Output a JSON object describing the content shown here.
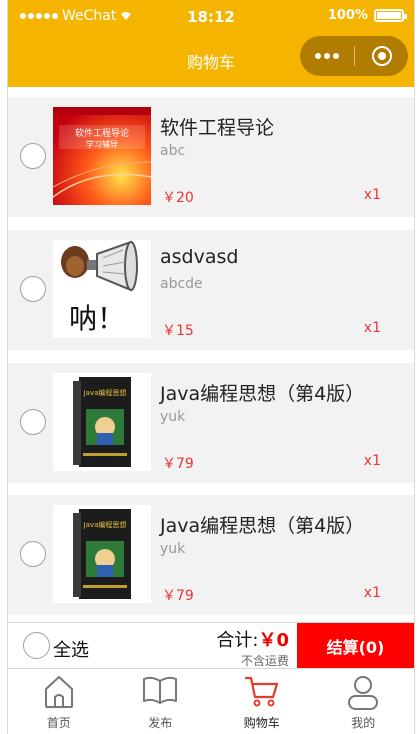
{
  "status_bar": {
    "carrier": "WeChat",
    "time": "18:12",
    "battery": "100%"
  },
  "nav": {
    "title": "购物车"
  },
  "cart_items": [
    {
      "name": "软件工程导论",
      "desc": "abc",
      "price": "￥20",
      "qty": "x1",
      "thumb_icon": "software-engineering-book-cover",
      "thumb_text": "软件工程导论 学习辅导"
    },
    {
      "name": "asdvasd",
      "desc": "abcde",
      "price": "￥15",
      "qty": "x1",
      "thumb_icon": "megaphone-meme-image",
      "thumb_text": "呐！"
    },
    {
      "name": "Java编程思想（第4版）",
      "desc": "yuk",
      "price": "￥79",
      "qty": "x1",
      "thumb_icon": "java-book-cover",
      "thumb_text": "Java编程思想"
    },
    {
      "name": "Java编程思想（第4版）",
      "desc": "yuk",
      "price": "￥79",
      "qty": "x1",
      "thumb_icon": "java-book-cover",
      "thumb_text": "Java编程思想"
    }
  ],
  "footer": {
    "select_all": "全选",
    "total_label": "合计:",
    "total_amount": "￥0",
    "shipping_note": "不含运费",
    "checkout": "结算(0)"
  },
  "tabs": [
    {
      "label": "首页",
      "icon": "home-icon"
    },
    {
      "label": "发布",
      "icon": "book-icon"
    },
    {
      "label": "购物车",
      "icon": "cart-icon"
    },
    {
      "label": "我的",
      "icon": "profile-icon"
    }
  ],
  "colors": {
    "brand": "#f5b400",
    "capsule": "#b07d00",
    "price": "#ee3333",
    "checkout": "#ff0000",
    "cart_active": "#e33b2e"
  }
}
